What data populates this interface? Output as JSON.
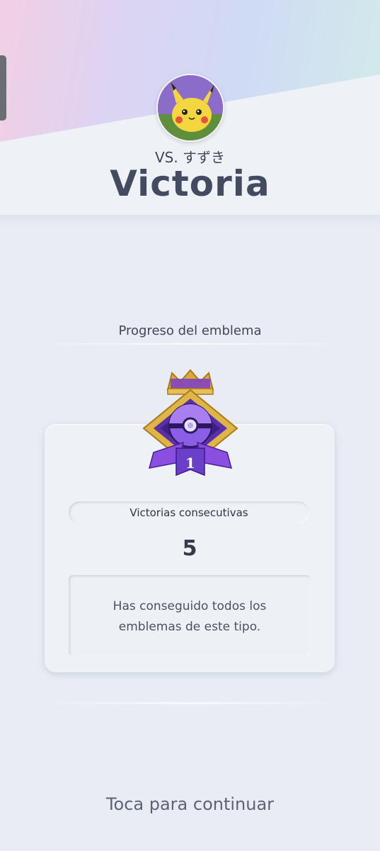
{
  "header": {
    "opponent_label": "VS. すずき",
    "result": "Victoria",
    "avatar_icon": "pikachu-avatar-icon"
  },
  "emblem_progress": {
    "section_title": "Progreso del emblema",
    "badge_icon": "pokeball-medal-icon",
    "badge_rank": "1",
    "stat_label": "Victorias consecutivas",
    "stat_value": "5",
    "message": "Has conseguido todos los emblemas de este tipo."
  },
  "footer": {
    "continue_prompt": "Toca para continuar"
  },
  "colors": {
    "title": "#434b60",
    "badge_purple": "#6a3fc9",
    "badge_gold": "#d9a93a"
  }
}
